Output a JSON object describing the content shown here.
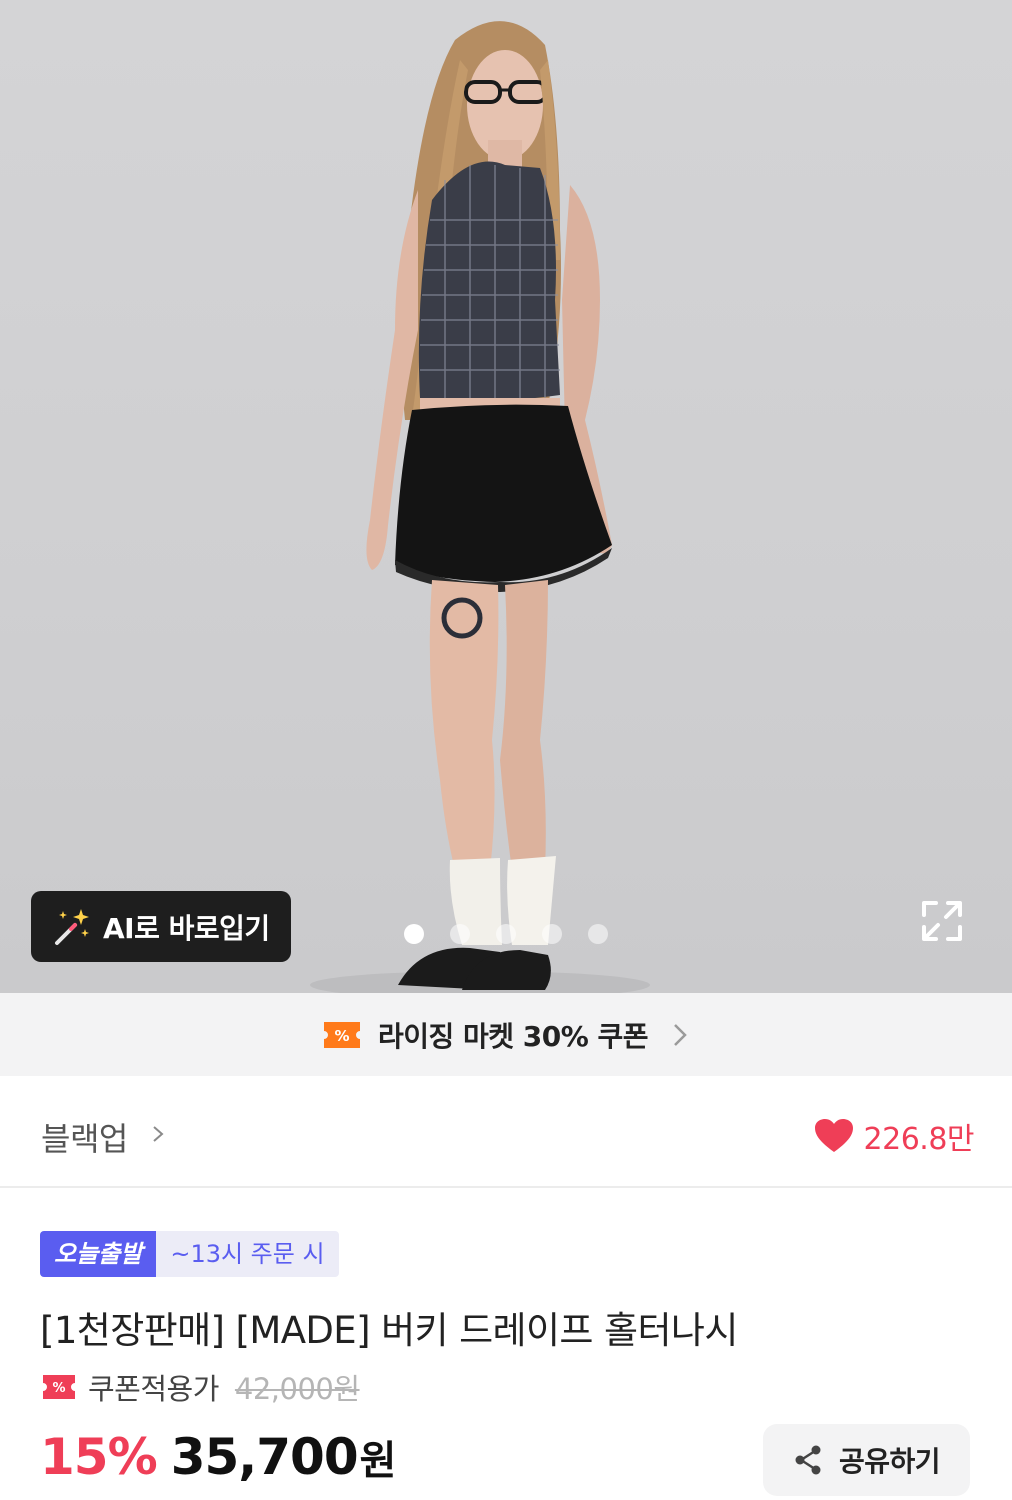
{
  "hero": {
    "ai_button_label": "AI로 바로입기",
    "slide_count": 5,
    "active_slide": 1
  },
  "coupon_banner": {
    "text": "라이징 마켓 30% 쿠폰"
  },
  "brand": {
    "name": "블랙업",
    "likes": "226.8만"
  },
  "product": {
    "badge_today": "오늘출발",
    "badge_time": "~13시 주문 시",
    "title": "[1천장판매] [MADE] 버키 드레이프 홀터나시",
    "coupon_label": "쿠폰적용가",
    "original_price": "42,000원",
    "discount": "15%",
    "price": "35,700",
    "currency": "원",
    "share_label": "공유하기"
  },
  "colors": {
    "accent_red": "#ef3e57",
    "badge_blue": "#5a5df0",
    "coupon_orange": "#ff7a1a"
  }
}
